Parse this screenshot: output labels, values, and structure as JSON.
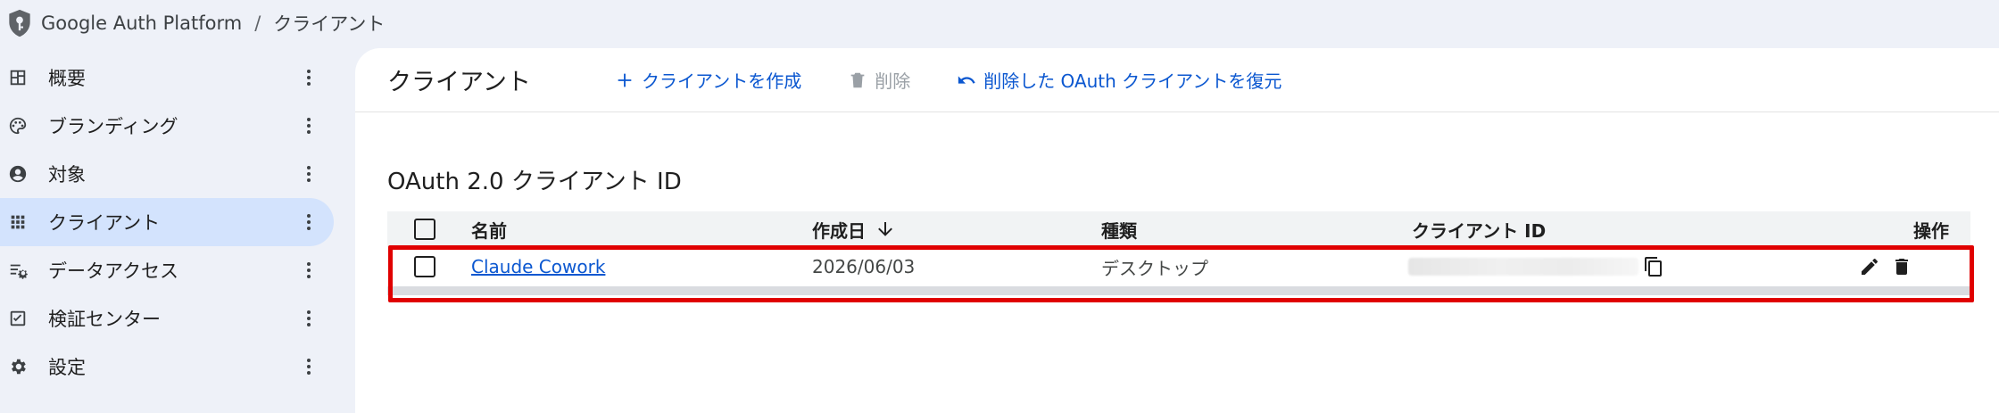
{
  "breadcrumb": {
    "app": "Google Auth Platform",
    "separator": "/",
    "current": "クライアント"
  },
  "sidebar": {
    "items": [
      {
        "label": "概要",
        "icon": "dashboard-icon",
        "active": false
      },
      {
        "label": "ブランディング",
        "icon": "palette-icon",
        "active": false
      },
      {
        "label": "対象",
        "icon": "account-circle-icon",
        "active": false
      },
      {
        "label": "クライアント",
        "icon": "apps-grid-icon",
        "active": true
      },
      {
        "label": "データアクセス",
        "icon": "data-settings-icon",
        "active": false
      },
      {
        "label": "検証センター",
        "icon": "check-box-icon",
        "active": false
      },
      {
        "label": "設定",
        "icon": "gear-icon",
        "active": false
      }
    ]
  },
  "toolbar": {
    "title": "クライアント",
    "create_label": "クライアントを作成",
    "delete_label": "削除",
    "restore_label": "削除した OAuth クライアントを復元"
  },
  "section": {
    "title": "OAuth 2.0 クライアント ID"
  },
  "table": {
    "headers": {
      "name": "名前",
      "created": "作成日",
      "type": "種類",
      "client_id": "クライアント ID",
      "actions": "操作"
    },
    "rows": [
      {
        "name": "Claude Cowork",
        "created": "2026/06/03",
        "type": "デスクトップ",
        "client_id_hidden": true
      }
    ]
  },
  "colors": {
    "accent": "#0b57d0",
    "active_nav": "#d3e3fd",
    "highlight": "#e00000",
    "background": "#eef1f8"
  }
}
